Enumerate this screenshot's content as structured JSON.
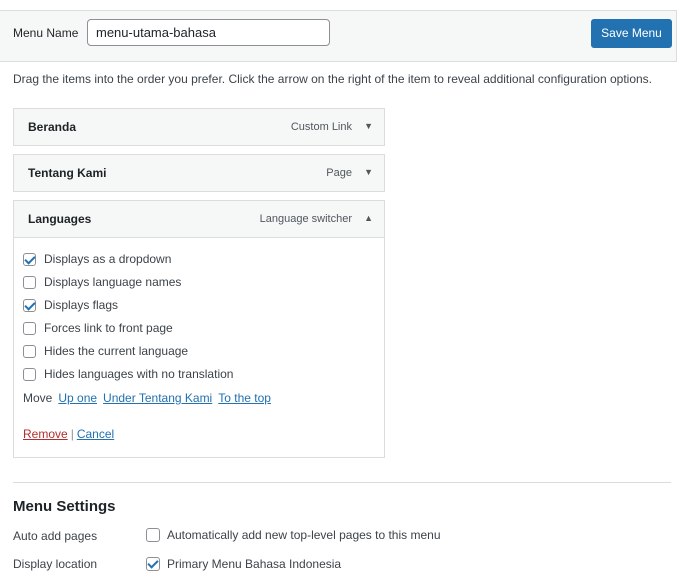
{
  "header": {
    "menu_name_label": "Menu Name",
    "menu_name_value": "menu-utama-bahasa",
    "save_label": "Save Menu"
  },
  "instructions": "Drag the items into the order you prefer. Click the arrow on the right of the item to reveal additional configuration options.",
  "items": [
    {
      "title": "Beranda",
      "type": "Custom Link",
      "arrow": "▼"
    },
    {
      "title": "Tentang Kami",
      "type": "Page",
      "arrow": "▼"
    },
    {
      "title": "Languages",
      "type": "Language switcher",
      "arrow": "▲"
    }
  ],
  "language_options": [
    {
      "label": "Displays as a dropdown",
      "checked": true
    },
    {
      "label": "Displays language names",
      "checked": false
    },
    {
      "label": "Displays flags",
      "checked": true
    },
    {
      "label": "Forces link to front page",
      "checked": false
    },
    {
      "label": "Hides the current language",
      "checked": false
    },
    {
      "label": "Hides languages with no translation",
      "checked": false
    }
  ],
  "move": {
    "label": "Move",
    "up_one": "Up one",
    "under": "Under Tentang Kami",
    "to_top": "To the top"
  },
  "actions": {
    "remove": "Remove",
    "separator": "|",
    "cancel": "Cancel"
  },
  "menu_settings": {
    "heading": "Menu Settings",
    "auto_add_label": "Auto add pages",
    "auto_add_option": "Automatically add new top-level pages to this menu",
    "auto_add_checked": false,
    "display_location_label": "Display location",
    "display_location_option": "Primary Menu Bahasa Indonesia",
    "display_location_checked": true
  },
  "colors": {
    "accent": "#2271b1",
    "remove": "#b32d2e",
    "panel_bg": "#f6f7f7",
    "border": "#dcdcde"
  }
}
